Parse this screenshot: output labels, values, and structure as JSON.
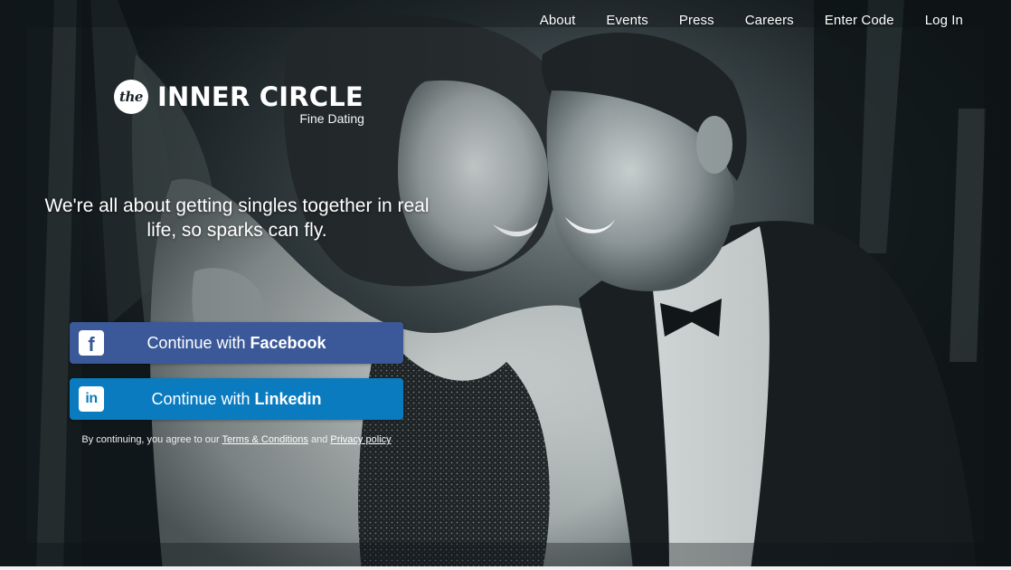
{
  "nav": {
    "items": [
      "About",
      "Events",
      "Press",
      "Careers",
      "Enter Code",
      "Log In"
    ]
  },
  "logo": {
    "badge": "the",
    "name": "INNER CIRCLE",
    "tagline": "Fine Dating"
  },
  "hero": {
    "headline": "We're all about getting singles together in real life, so sparks can fly."
  },
  "buttons": {
    "facebook": {
      "prefix": "Continue with ",
      "brand": "Facebook",
      "icon": "facebook-icon",
      "icon_glyph": "f",
      "color": "#3b5998"
    },
    "linkedin": {
      "prefix": "Continue with ",
      "brand": "Linkedin",
      "icon": "linkedin-icon",
      "icon_glyph": "in",
      "color": "#0a7bbf"
    }
  },
  "legal": {
    "prefix": "By continuing, you agree to our ",
    "terms_link": "Terms & Conditions",
    "conjunction": " and ",
    "privacy_link": "Privacy policy"
  }
}
